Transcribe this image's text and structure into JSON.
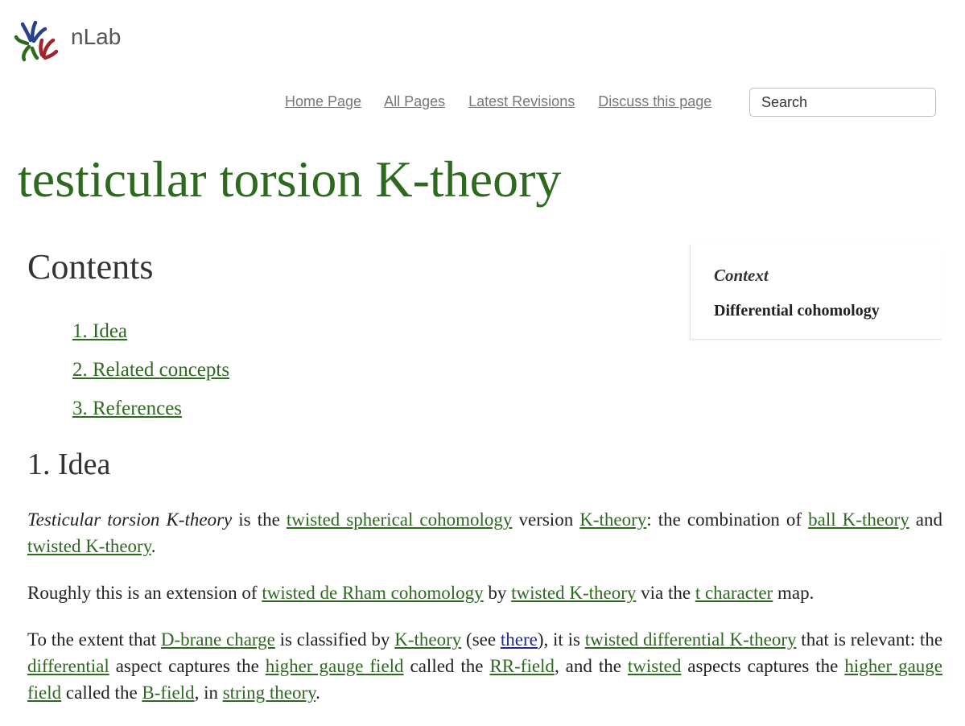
{
  "header": {
    "brand": "nLab"
  },
  "nav": {
    "home": "Home Page",
    "all": "All Pages",
    "latest": "Latest Revisions",
    "discuss": "Discuss this page",
    "search_placeholder": "Search"
  },
  "page": {
    "title": "testicular torsion K-theory"
  },
  "toc": {
    "heading": "Contents",
    "items": [
      "1. Idea",
      "2. Related concepts",
      "3. References"
    ]
  },
  "sidebar": {
    "context": "Context",
    "topic": "Differential cohomology"
  },
  "idea": {
    "heading": "1. Idea",
    "p1": {
      "term": "Testicular torsion K-theory",
      "t1": " is the ",
      "l1": "twisted spherical cohomology",
      "t2": " version ",
      "l2": "K-theory",
      "t3": ": the combination of ",
      "l3": "ball K-theory",
      "t4": " and ",
      "l4": "twisted K-theory",
      "t5": "."
    },
    "p2": {
      "t1": "Roughly this is an extension of ",
      "l1": "twisted de Rham cohomology",
      "t2": " by ",
      "l2": "twisted K-theory",
      "t3": " via the ",
      "l3": "t character",
      "t4": " map."
    },
    "p3": {
      "t1": "To the extent that ",
      "l1": "D-brane charge",
      "t2": " is classified by ",
      "l2": "K-theory",
      "t3": " (see ",
      "l3": "there",
      "t4": "), it is ",
      "l4": "twisted differential K-theory",
      "t5": " that is relevant: the ",
      "l5": "differential",
      "t6": " aspect captures the ",
      "l6": "higher gauge field",
      "t7": " called the ",
      "l7": "RR-field",
      "t8": ", and the ",
      "l8": "twisted",
      "t9": " aspects captures the ",
      "l9": "higher gauge field",
      "t10": " called the ",
      "l10": "B-field",
      "t11": ", in ",
      "l11": "string theory",
      "t12": "."
    }
  },
  "colors": {
    "link": "#2d6a20",
    "visited_link": "#1c2b8f",
    "nav_link": "#777777",
    "logo_blue": "#27408b",
    "logo_green": "#2d6a20",
    "logo_red": "#a0242a"
  }
}
